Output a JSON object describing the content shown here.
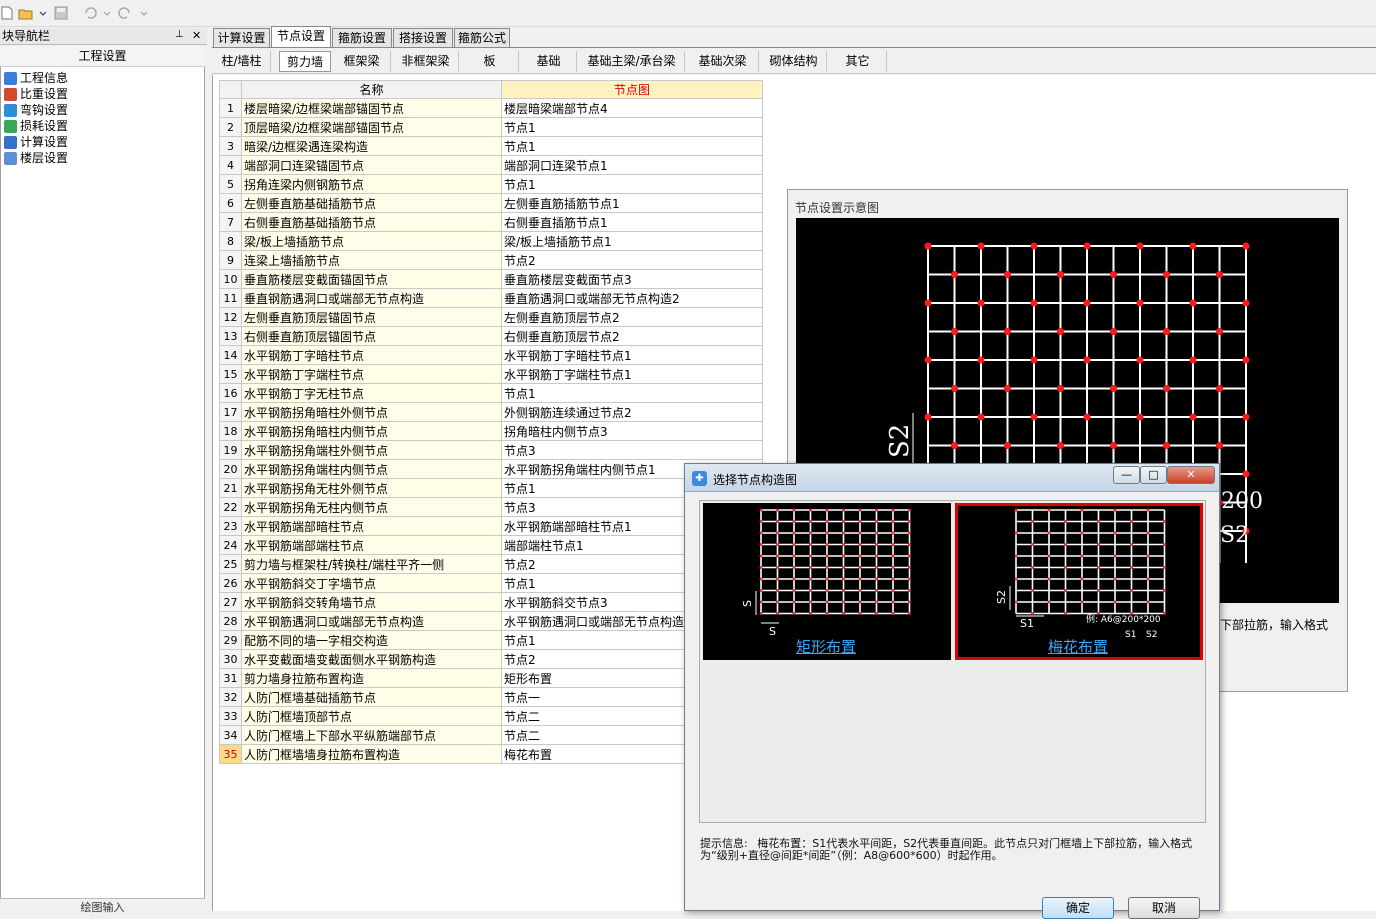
{
  "toolbar": {
    "icons": [
      "new-icon",
      "open-icon",
      "save-icon",
      "undo-icon",
      "redo-icon"
    ]
  },
  "nav": {
    "title": "块导航栏",
    "section": "工程设置",
    "items": [
      {
        "label": "工程信息",
        "icon": "info-icon"
      },
      {
        "label": "比重设置",
        "icon": "weight-icon"
      },
      {
        "label": "弯钩设置",
        "icon": "hook-icon"
      },
      {
        "label": "损耗设置",
        "icon": "loss-icon"
      },
      {
        "label": "计算设置",
        "icon": "calc-icon"
      },
      {
        "label": "楼层设置",
        "icon": "floor-icon"
      }
    ],
    "bottom": "绘图输入"
  },
  "tabs": [
    "计算设置",
    "节点设置",
    "箍筋设置",
    "搭接设置",
    "箍筋公式"
  ],
  "active_tab": "节点设置",
  "subtabs": [
    "柱/墙柱",
    "剪力墙",
    "框架梁",
    "非框架梁",
    "板",
    "基础",
    "基础主梁/承台梁",
    "基础次梁",
    "砌体结构",
    "其它"
  ],
  "active_subtab": "剪力墙",
  "grid": {
    "headers": [
      "名称",
      "节点图"
    ],
    "rows": [
      {
        "n": "1",
        "name": "楼层暗梁/边框梁端部锚固节点",
        "value": "楼层暗梁端部节点4"
      },
      {
        "n": "2",
        "name": "顶层暗梁/边框梁端部锚固节点",
        "value": "节点1"
      },
      {
        "n": "3",
        "name": "暗梁/边框梁遇连梁构造",
        "value": "节点1"
      },
      {
        "n": "4",
        "name": "端部洞口连梁锚固节点",
        "value": "端部洞口连梁节点1"
      },
      {
        "n": "5",
        "name": "拐角连梁内侧钢筋节点",
        "value": "节点1"
      },
      {
        "n": "6",
        "name": "左侧垂直筋基础插筋节点",
        "value": "左侧垂直筋插筋节点1"
      },
      {
        "n": "7",
        "name": "右侧垂直筋基础插筋节点",
        "value": "右侧垂直插筋节点1"
      },
      {
        "n": "8",
        "name": "梁/板上墙插筋节点",
        "value": "梁/板上墙插筋节点1"
      },
      {
        "n": "9",
        "name": "连梁上墙插筋节点",
        "value": "节点2"
      },
      {
        "n": "10",
        "name": "垂直筋楼层变截面锚固节点",
        "value": "垂直筋楼层变截面节点3"
      },
      {
        "n": "11",
        "name": "垂直钢筋遇洞口或端部无节点构造",
        "value": "垂直筋遇洞口或端部无节点构造2"
      },
      {
        "n": "12",
        "name": "左侧垂直筋顶层锚固节点",
        "value": "左侧垂直筋顶层节点2"
      },
      {
        "n": "13",
        "name": "右侧垂直筋顶层锚固节点",
        "value": "右侧垂直筋顶层节点2"
      },
      {
        "n": "14",
        "name": "水平钢筋丁字暗柱节点",
        "value": "水平钢筋丁字暗柱节点1"
      },
      {
        "n": "15",
        "name": "水平钢筋丁字端柱节点",
        "value": "水平钢筋丁字端柱节点1"
      },
      {
        "n": "16",
        "name": "水平钢筋丁字无柱节点",
        "value": "节点1"
      },
      {
        "n": "17",
        "name": "水平钢筋拐角暗柱外侧节点",
        "value": "外侧钢筋连续通过节点2"
      },
      {
        "n": "18",
        "name": "水平钢筋拐角暗柱内侧节点",
        "value": "拐角暗柱内侧节点3"
      },
      {
        "n": "19",
        "name": "水平钢筋拐角端柱外侧节点",
        "value": "节点3"
      },
      {
        "n": "20",
        "name": "水平钢筋拐角端柱内侧节点",
        "value": "水平钢筋拐角端柱内侧节点1"
      },
      {
        "n": "21",
        "name": "水平钢筋拐角无柱外侧节点",
        "value": "节点1"
      },
      {
        "n": "22",
        "name": "水平钢筋拐角无柱内侧节点",
        "value": "节点3"
      },
      {
        "n": "23",
        "name": "水平钢筋端部暗柱节点",
        "value": "水平钢筋端部暗柱节点1"
      },
      {
        "n": "24",
        "name": "水平钢筋端部端柱节点",
        "value": "端部端柱节点1"
      },
      {
        "n": "25",
        "name": "剪力墙与框架柱/转换柱/端柱平齐一侧",
        "value": "节点2"
      },
      {
        "n": "26",
        "name": "水平钢筋斜交丁字墙节点",
        "value": "节点1"
      },
      {
        "n": "27",
        "name": "水平钢筋斜交转角墙节点",
        "value": "水平钢筋斜交节点3"
      },
      {
        "n": "28",
        "name": "水平钢筋遇洞口或端部无节点构造",
        "value": "水平钢筋遇洞口或端部无节点构造"
      },
      {
        "n": "29",
        "name": "配筋不同的墙一字相交构造",
        "value": "节点1"
      },
      {
        "n": "30",
        "name": "水平变截面墙变截面侧水平钢筋构造",
        "value": "节点2"
      },
      {
        "n": "31",
        "name": "剪力墙身拉筋布置构造",
        "value": "矩形布置"
      },
      {
        "n": "32",
        "name": "人防门框墙基础插筋节点",
        "value": "节点一"
      },
      {
        "n": "33",
        "name": "人防门框墙顶部节点",
        "value": "节点二"
      },
      {
        "n": "34",
        "name": "人防门框墙上下部水平纵筋端部节点",
        "value": "节点二"
      },
      {
        "n": "35",
        "name": "人防门框墙墙身拉筋布置构造",
        "value": "梅花布置"
      }
    ],
    "selected_row": "35"
  },
  "preview": {
    "title": "节点设置示意图",
    "side_text": "下部拉筋，输入格式",
    "label_s2": "S2",
    "label_200": "200",
    "label_s2_bottom": "S2"
  },
  "dialog": {
    "title": "选择节点构造图",
    "option1": {
      "label": "矩形布置",
      "s_v": "S",
      "s_h": "S"
    },
    "option2": {
      "label": "梅花布置",
      "s_v": "S2",
      "s_h": "S1",
      "example": "例: A6@200*200",
      "ex_s1": "S1",
      "ex_s2": "S2"
    },
    "hint_label": "提示信息:",
    "hint_text": "梅花布置：S1代表水平间距，S2代表垂直间距。此节点只对门框墙上下部拉筋，输入格式为“级别+直径@间距*间距”（例：A8@600*600）时起作用。",
    "ok": "确定",
    "cancel": "取消",
    "minimize": "—",
    "maximize": "□",
    "close": "✕"
  },
  "colors": {
    "grid_line": "#ffffff",
    "node": "#ff0000",
    "selected": "#e00000",
    "link": "#37a8ff"
  }
}
